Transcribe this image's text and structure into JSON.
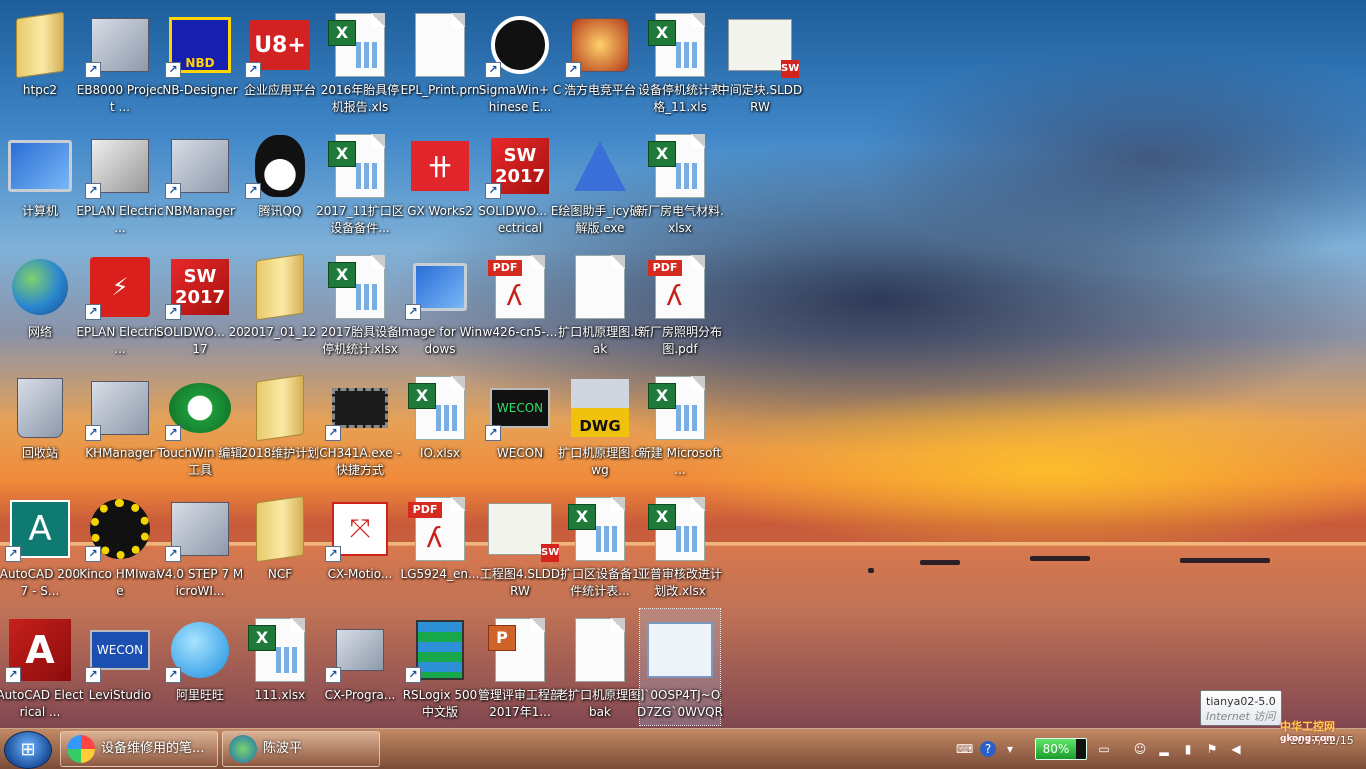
{
  "desktop_icons": [
    {
      "label": "htpc2",
      "shortcut": false
    },
    {
      "label": "EB8000 Project ...",
      "shortcut": true
    },
    {
      "label": "NB-Designer",
      "shortcut": true,
      "badge": "NBD"
    },
    {
      "label": "企业应用平台",
      "shortcut": true,
      "badge": "U8+"
    },
    {
      "label": "2016年胎具停机报告.xls",
      "shortcut": false,
      "badge": "X"
    },
    {
      "label": "EPL_Print.prn",
      "shortcut": false
    },
    {
      "label": "SigmaWin+ Chinese E...",
      "shortcut": true
    },
    {
      "label": "浩方电竞平台",
      "shortcut": true
    },
    {
      "label": "设备停机统计表格_11.xls",
      "shortcut": false,
      "badge": "X"
    },
    {
      "label": "中间定块.SLDDRW",
      "shortcut": false,
      "badge": "SW"
    },
    {
      "label": "计算机",
      "shortcut": false
    },
    {
      "label": "EPLAN Electric ...",
      "shortcut": true
    },
    {
      "label": "NBManager",
      "shortcut": true
    },
    {
      "label": "腾讯QQ",
      "shortcut": true
    },
    {
      "label": "2017_11扩口区设备备件...",
      "shortcut": false,
      "badge": "X"
    },
    {
      "label": "GX Works2",
      "shortcut": true
    },
    {
      "label": "SOLIDWO... Electrical",
      "shortcut": true,
      "badge": "SW 2017"
    },
    {
      "label": "绘图助手_icy破解版.exe",
      "shortcut": false
    },
    {
      "label": "新厂房电气材料.xlsx",
      "shortcut": false,
      "badge": "X"
    },
    {
      "label": "网络",
      "shortcut": false
    },
    {
      "label": "EPLAN Electric ...",
      "shortcut": true
    },
    {
      "label": "SOLIDWO... 2017",
      "shortcut": true,
      "badge": "SW 2017"
    },
    {
      "label": "2017_01_12",
      "shortcut": false
    },
    {
      "label": "2017胎具设备停机统计.xlsx",
      "shortcut": false,
      "badge": "X"
    },
    {
      "label": "Image for Windows",
      "shortcut": true
    },
    {
      "label": "w426-cn5-...",
      "shortcut": false,
      "badge": "PDF"
    },
    {
      "label": "扩口机原理图.bak",
      "shortcut": false
    },
    {
      "label": "新厂房照明分布图.pdf",
      "shortcut": false,
      "badge": "PDF"
    },
    {
      "label": "回收站",
      "shortcut": false
    },
    {
      "label": "KHManager",
      "shortcut": true
    },
    {
      "label": "TouchWin 编辑工具",
      "shortcut": true,
      "badge": "T"
    },
    {
      "label": "2018维护计划",
      "shortcut": false
    },
    {
      "label": "CH341A.exe - 快捷方式",
      "shortcut": true
    },
    {
      "label": "IO.xlsx",
      "shortcut": false,
      "badge": "X"
    },
    {
      "label": "WECON",
      "shortcut": true,
      "badge": "WECON"
    },
    {
      "label": "扩口机原理图.dwg",
      "shortcut": false,
      "badge": "DWG"
    },
    {
      "label": "新建 Microsoft ...",
      "shortcut": false,
      "badge": "X"
    },
    {
      "label": "AutoCAD 2007 - S...",
      "shortcut": true,
      "badge": "A"
    },
    {
      "label": "Kinco HMIware",
      "shortcut": true
    },
    {
      "label": "V4.0 STEP 7 MicroWI...",
      "shortcut": true
    },
    {
      "label": "NCF",
      "shortcut": false
    },
    {
      "label": "CX-Motio...",
      "shortcut": true
    },
    {
      "label": "LG5924_en...",
      "shortcut": false,
      "badge": "PDF"
    },
    {
      "label": "工程图4.SLDDRW",
      "shortcut": false,
      "badge": "SW"
    },
    {
      "label": "扩口区设备备1件统计表...",
      "shortcut": false,
      "badge": "X"
    },
    {
      "label": "亚普审核改进计划改.xlsx",
      "shortcut": false,
      "badge": "X"
    },
    {
      "label": "AutoCAD Electrical ...",
      "shortcut": true,
      "badge": "A"
    },
    {
      "label": "LeviStudio",
      "shortcut": true,
      "badge": "WECON"
    },
    {
      "label": "阿里旺旺",
      "shortcut": true
    },
    {
      "label": "111.xlsx",
      "shortcut": false,
      "badge": "X"
    },
    {
      "label": "CX-Progra...",
      "shortcut": true
    },
    {
      "label": "RSLogix 500 中文版",
      "shortcut": true
    },
    {
      "label": "管理评审工程部2017年1...",
      "shortcut": false,
      "badge": "P"
    },
    {
      "label": "老扩口机原理图.bak",
      "shortcut": false
    },
    {
      "label": "]`0OSP4TJ~OD7ZG`0WVQRPC.png",
      "shortcut": false
    }
  ],
  "taskbar": {
    "start_label": "Start",
    "tasks": [
      {
        "label": "设备维修用的笔..."
      },
      {
        "label": "陈波平"
      }
    ],
    "battery_percent": "80%",
    "clock_time": "",
    "clock_date": "2017/12/15"
  },
  "tooltip": {
    "title": "tianya02-5.0",
    "subtitle": "Internet 访问"
  },
  "watermark": {
    "line1": "中华工控网",
    "line2": "gkong.com"
  },
  "colors": {
    "excel_green": "#1f7a3a",
    "pdf_red": "#d42a20",
    "solidworks_red": "#e8282a",
    "battery_green": "#3ccf4e"
  }
}
